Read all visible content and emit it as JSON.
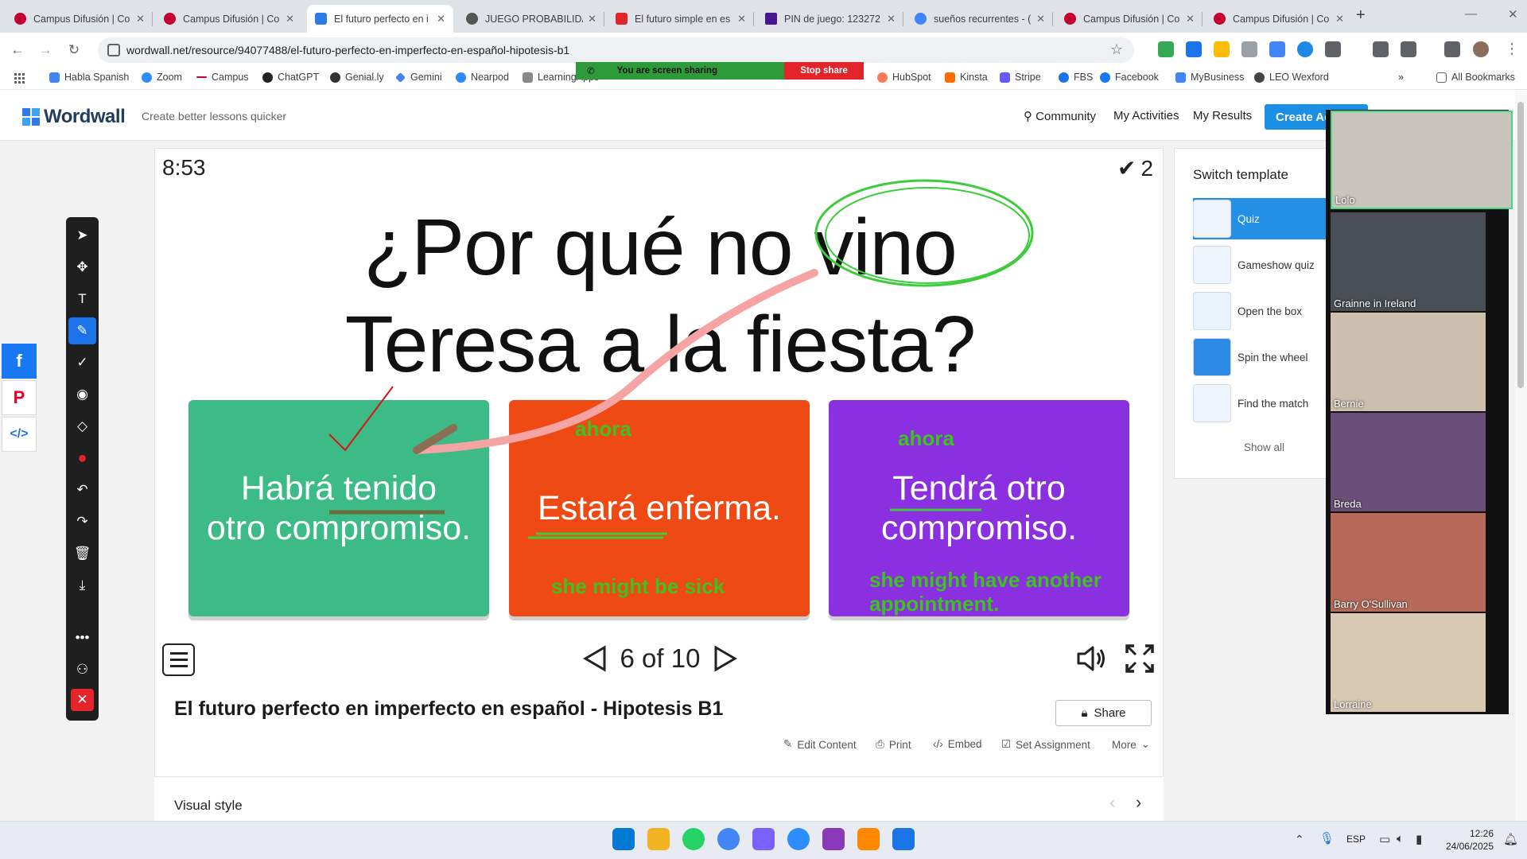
{
  "browser": {
    "tabs": [
      {
        "title": "Campus Difusión | Co",
        "active": false,
        "favicon_color": "#c3002f"
      },
      {
        "title": "Campus Difusión | Co",
        "active": false,
        "favicon_color": "#c3002f"
      },
      {
        "title": "El futuro perfecto en i",
        "active": true,
        "favicon_color": "#2d7be5"
      },
      {
        "title": "JUEGO PROBABILIDAD",
        "active": false,
        "favicon_color": "#555555"
      },
      {
        "title": "El futuro simple en es",
        "active": false,
        "favicon_color": "#e0262b"
      },
      {
        "title": "PIN de juego: 123272",
        "active": false,
        "favicon_color": "#46178f"
      },
      {
        "title": "sueños recurrentes - (",
        "active": false,
        "favicon_color": "#4285f4"
      },
      {
        "title": "Campus Difusión | Co",
        "active": false,
        "favicon_color": "#c3002f"
      },
      {
        "title": "Campus Difusión | Co",
        "active": false,
        "favicon_color": "#c3002f"
      }
    ],
    "url": "wordwall.net/resource/94077488/el-futuro-perfecto-en-imperfecto-en-español-hipotesis-b1",
    "bookmarks": [
      {
        "label": "Habla Spanish",
        "color": "#4285f4"
      },
      {
        "label": "Zoom",
        "color": "#2d8cff"
      },
      {
        "label": "Campus",
        "color": "#c3002f"
      },
      {
        "label": "ChatGPT",
        "color": "#222222"
      },
      {
        "label": "Genial.ly",
        "color": "#333333"
      },
      {
        "label": "Gemini",
        "color": "#4285f4"
      },
      {
        "label": "Nearpod",
        "color": "#2e8bff"
      },
      {
        "label": "LearningApps",
        "color": "#888888"
      },
      {
        "label": "HubSpot",
        "color": "#ff7a59"
      },
      {
        "label": "Kinsta",
        "color": "#ff6b00"
      },
      {
        "label": "Stripe",
        "color": "#635bff"
      },
      {
        "label": "FBS",
        "color": "#1a73e8"
      },
      {
        "label": "Facebook",
        "color": "#1877f2"
      },
      {
        "label": "MyBusiness",
        "color": "#4285f4"
      },
      {
        "label": "LEO Wexford",
        "color": "#444444"
      }
    ],
    "all_bookmarks": "All Bookmarks",
    "screen_share": {
      "status": "You are screen sharing",
      "stop": "Stop share"
    }
  },
  "wordwall": {
    "logo": "Wordwall",
    "tagline": "Create better lessons quicker",
    "nav": [
      "Community",
      "My Activities",
      "My Results"
    ],
    "create_button": "Create Ac"
  },
  "game": {
    "timer": "8:53",
    "score": "2",
    "question_line1": "¿Por qué no vino",
    "question_line2": "Teresa a la fiesta?",
    "answers": [
      {
        "line1": "Habrá tenido",
        "line2": "otro compromiso.",
        "color": "#3dbb87"
      },
      {
        "line1": "Estará enferma.",
        "line2": "",
        "color": "#ef4a14"
      },
      {
        "line1": "Tendrá otro",
        "line2": "compromiso.",
        "color": "#8a30e0"
      }
    ],
    "annotations": {
      "ahora_1": "ahora",
      "ahora_2": "ahora",
      "hint_2": "she might be sick",
      "hint_3_line1": "she might have another",
      "hint_3_line2": "appointment."
    },
    "pager": {
      "current": 6,
      "total": 10,
      "text": "6 of 10"
    }
  },
  "activity": {
    "title": "El futuro perfecto en imperfecto en español - Hipotesis B1",
    "share": "Share",
    "actions": [
      "Edit Content",
      "Print",
      "Embed",
      "Set Assignment",
      "More"
    ]
  },
  "visual_style": "Visual style",
  "templates": {
    "title": "Switch template",
    "items": [
      "Quiz",
      "Gameshow quiz",
      "Open the box",
      "Spin the wheel",
      "Find the match"
    ],
    "active": "Quiz",
    "show_all": "Show all"
  },
  "participants": [
    "Lolo",
    "Grainne in Ireland",
    "Bernie",
    "Breda",
    "Barry O'Sullivan",
    "Lorraine"
  ],
  "taskbar": {
    "language": "ESP",
    "time": "12:26",
    "date": "24/06/2025"
  }
}
